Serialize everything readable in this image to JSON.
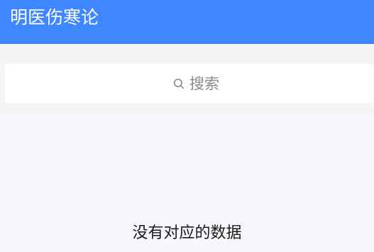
{
  "header": {
    "title": "明医伤寒论",
    "background_color": "#3f87ff"
  },
  "search": {
    "icon": "search-icon",
    "placeholder": "搜索"
  },
  "list": {
    "empty_text": "没有对应的数据"
  }
}
